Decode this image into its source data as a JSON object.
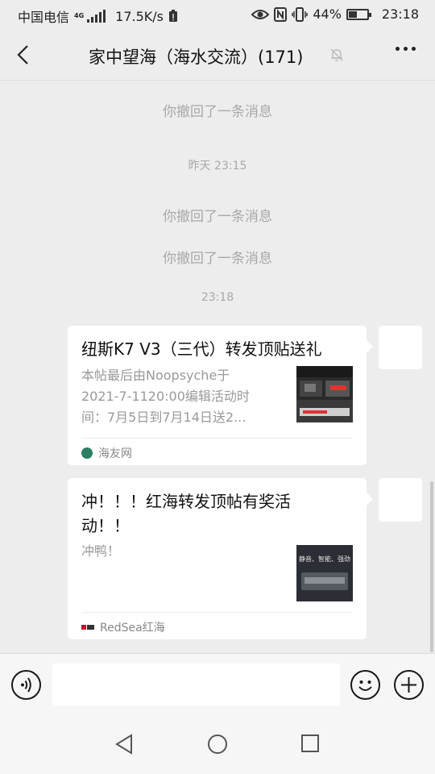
{
  "status_bar": {
    "carrier": "中国电信",
    "network_type": "4G",
    "speed": "17.5K/s",
    "battery_percent": "44%",
    "battery_level": 0.44,
    "time": "23:18"
  },
  "header": {
    "title": "家中望海（海水交流）(171)"
  },
  "messages": {
    "recall_1": "你撤回了一条消息",
    "timestamp_1": "昨天 23:15",
    "recall_2": "你撤回了一条消息",
    "recall_3": "你撤回了一条消息",
    "timestamp_2": "23:18"
  },
  "cards": [
    {
      "title": "纽斯K7 V3（三代）转发顶贴送礼",
      "desc_lines": [
        "本帖最后由Noopsyche于",
        "2021-7-1120:00编辑活动时",
        "间：7月5日到7月14日送2..."
      ],
      "source": "海友网",
      "source_color": "#2a7f62"
    },
    {
      "title_lines": [
        "冲！！！红海转发顶帖有奖活",
        "动！！"
      ],
      "desc": "冲鸭！",
      "source": "RedSea红海",
      "source_logo_text": "RedSea",
      "thumb_text": "静音、智能、强劲"
    }
  ],
  "colors": {
    "background": "#ededed",
    "card": "#ffffff",
    "system_text": "#a8a8a8"
  }
}
